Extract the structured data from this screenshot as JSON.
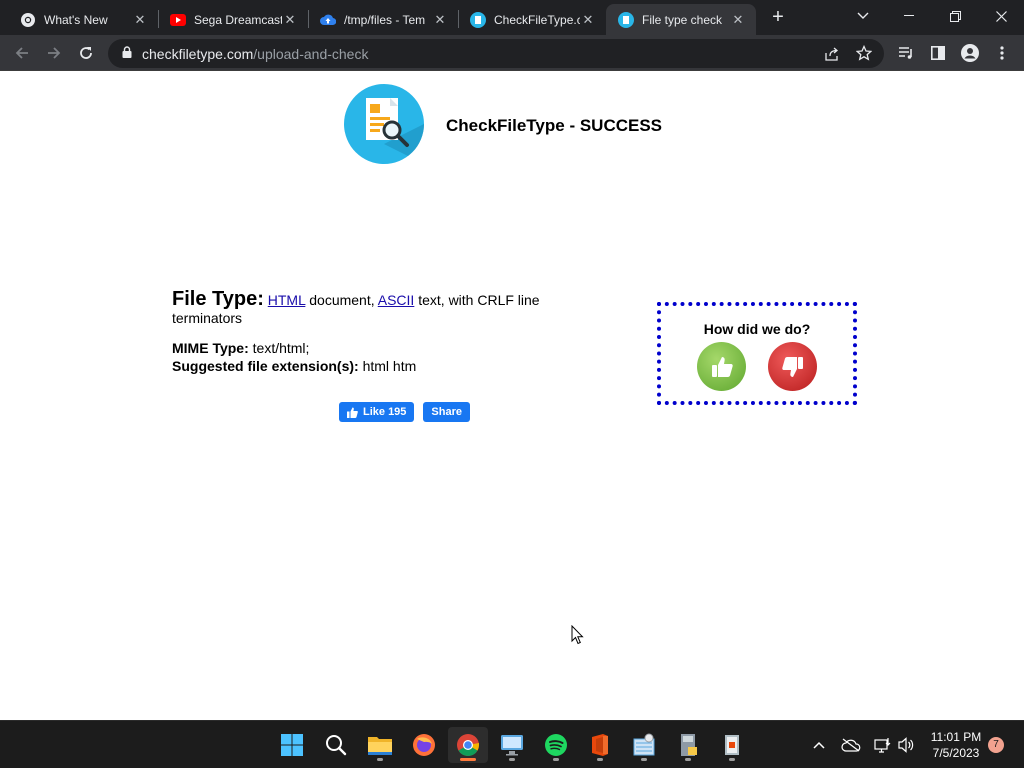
{
  "browser": {
    "tabs": [
      {
        "title": "What's New",
        "icon": "chrome-icon",
        "active": false
      },
      {
        "title": "Sega Dreamcast",
        "icon": "youtube-icon",
        "active": false
      },
      {
        "title": "/tmp/files - Tem",
        "icon": "cloud-upload-icon",
        "active": false
      },
      {
        "title": "CheckFileType.c",
        "icon": "checkfiletype-icon",
        "active": false
      },
      {
        "title": "File type check",
        "icon": "checkfiletype-icon",
        "active": true
      }
    ],
    "new_tab": "+",
    "url_domain": "checkfiletype.com",
    "url_path": "/upload-and-check"
  },
  "page": {
    "site_title": "CheckFileType - SUCCESS",
    "file_type_label": "File Type:",
    "file_type_link1": "HTML",
    "file_type_text1": " document, ",
    "file_type_link2": "ASCII",
    "file_type_text2": " text, with CRLF line terminators",
    "mime_label": "MIME Type:",
    "mime_value": "text/html;",
    "ext_label": "Suggested file extension(s):",
    "ext_value": "html htm",
    "fb_like": "Like 195",
    "fb_share": "Share",
    "feedback_question": "How did we do?"
  },
  "taskbar": {
    "time": "11:01 PM",
    "date": "7/5/2023",
    "notifications": "7"
  },
  "colors": {
    "accent_blue": "#1877f2",
    "feedback_border": "#0000cc",
    "thumb_up": "#7cc242",
    "thumb_down": "#d62828",
    "logo_bg": "#29b6e8"
  }
}
